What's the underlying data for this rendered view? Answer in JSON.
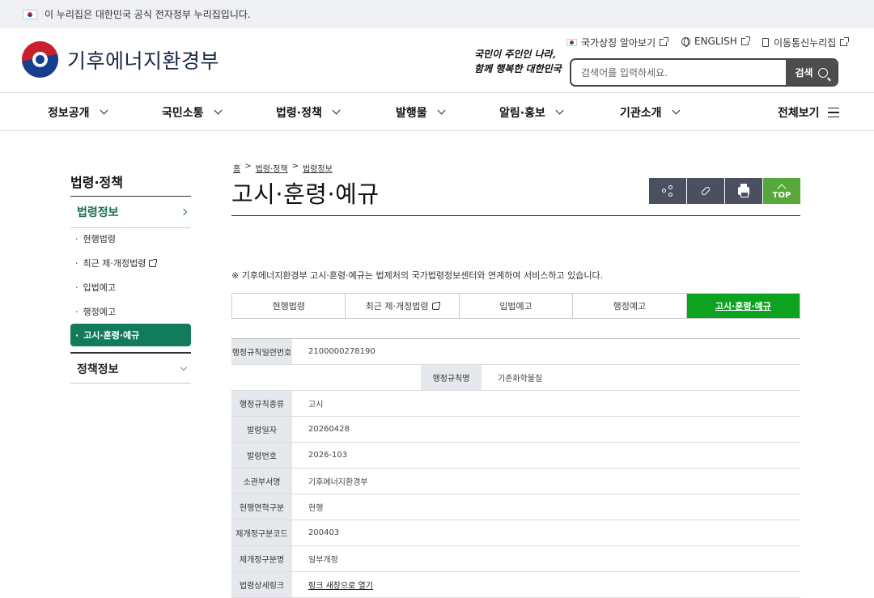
{
  "gov_banner": {
    "text": "이 누리집은 대한민국 공식 전자정부 누리집입니다."
  },
  "header": {
    "logo_text": "기후에너지환경부",
    "slogan_line1": "국민이 주인인 나라,",
    "slogan_line2": "함께 행복한 대한민국",
    "util_links": [
      "국가상징 알아보기",
      "ENGLISH",
      "이동통신누리집"
    ],
    "search": {
      "placeholder": "검색어를 입력하세요.",
      "button_label": "검색"
    }
  },
  "gnb": {
    "items": [
      "정보공개",
      "국민소통",
      "법령·정책",
      "발행물",
      "알림·홍보",
      "기관소개"
    ],
    "all_menu": "전체보기"
  },
  "sidebar": {
    "title": "법령·정책",
    "section1": "법령정보",
    "items": [
      "현행법령",
      "최근 제·개정법령",
      "입법예고",
      "행정예고",
      "고시·훈령·예규"
    ],
    "section2": "정책정보"
  },
  "breadcrumb": [
    "홈",
    ">",
    "법령·정책",
    ">",
    "법령정보"
  ],
  "page_title": "고시·훈령·예규",
  "tools": {
    "top_label": "TOP"
  },
  "notice": "※ 기후에너지환경부 고시·훈령·예규는 법제처의 국가법령정보센터와 연계하여 서비스하고 있습니다.",
  "tabs": [
    "현행법령",
    "최근 제·개정법령",
    "입법예고",
    "행정예고",
    "고시·훈령·예규"
  ],
  "active_tab_index": 4,
  "detail": {
    "serial_label": "행정규칙일련번호",
    "serial_value": "2100000278190",
    "name_label": "행정규칙명",
    "name_value": "기존화학물질",
    "rows": [
      {
        "label": "행정규칙종류",
        "value": "고시"
      },
      {
        "label": "발령일자",
        "value": "20260428"
      },
      {
        "label": "발령번호",
        "value": "2026-103"
      },
      {
        "label": "소관부서명",
        "value": "기후에너지환경부"
      },
      {
        "label": "현행연혁구분",
        "value": "현행"
      },
      {
        "label": "제개정구분코드",
        "value": "200403"
      },
      {
        "label": "제개정구분명",
        "value": "일부개정"
      },
      {
        "label": "법령상세링크",
        "value": "링크 새창으로 열기"
      }
    ]
  },
  "colors": {
    "brand_green": "#127b5c",
    "tab_active": "#0ba320",
    "tool_dark": "#4a5060",
    "top_green": "#57a83a"
  }
}
